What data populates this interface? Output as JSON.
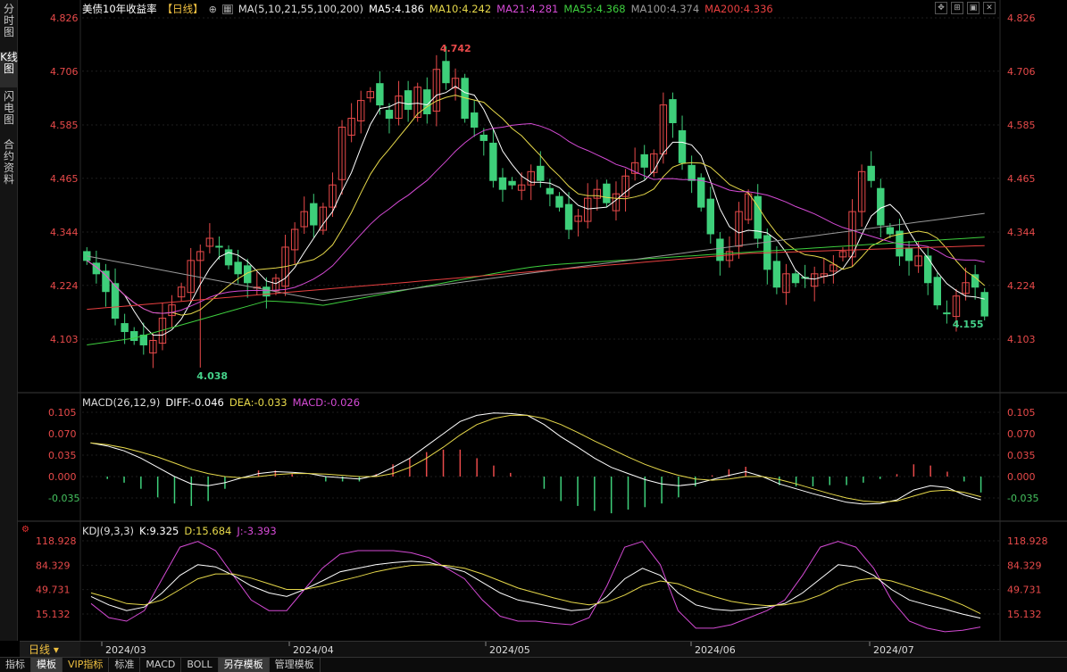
{
  "sidebar": {
    "tabs": [
      {
        "label": "分时图"
      },
      {
        "label": "K线图"
      },
      {
        "label": "闪电图"
      },
      {
        "label": "合约资料"
      }
    ]
  },
  "price_panel": {
    "title": "美债10年收益率",
    "period_badge": "【日线】",
    "ma_header": "MA(5,10,21,55,100,200)",
    "ma": [
      {
        "label": "MA5:4.186",
        "color": "#ffffff"
      },
      {
        "label": "MA10:4.242",
        "color": "#e6d84a"
      },
      {
        "label": "MA21:4.281",
        "color": "#d44ad4"
      },
      {
        "label": "MA55:4.368",
        "color": "#3ecf3e"
      },
      {
        "label": "MA100:4.374",
        "color": "#9a9a9a"
      },
      {
        "label": "MA200:4.336",
        "color": "#e84040"
      }
    ],
    "y_ticks": [
      "4.826",
      "4.706",
      "4.585",
      "4.465",
      "4.344",
      "4.224",
      "4.103"
    ],
    "high_label": "4.742",
    "low_label": "4.038",
    "last_label": "4.155"
  },
  "macd_panel": {
    "header": "MACD(26,12,9)",
    "diff": "DIFF:-0.046",
    "dea": "DEA:-0.033",
    "macd": "MACD:-0.026",
    "y_ticks": [
      "0.105",
      "0.070",
      "0.035",
      "0.000",
      "-0.035"
    ]
  },
  "kdj_panel": {
    "header": "KDJ(9,3,3)",
    "k": "K:9.325",
    "d": "D:15.684",
    "j": "J:-3.393",
    "y_ticks": [
      "118.928",
      "84.329",
      "49.731",
      "15.132"
    ]
  },
  "time_axis": {
    "period": "日线",
    "labels": [
      "2024/03",
      "2024/04",
      "2024/05",
      "2024/06",
      "2024/07"
    ]
  },
  "bottom_tabs": [
    {
      "label": "指标"
    },
    {
      "label": "模板"
    },
    {
      "label": "VIP指标"
    },
    {
      "label": "标准"
    },
    {
      "label": "MACD"
    },
    {
      "label": "BOLL"
    },
    {
      "label": "另存模板"
    },
    {
      "label": "管理模板"
    }
  ],
  "colors": {
    "up": "#e84a4a",
    "down": "#3ecf7a",
    "ma5": "#ffffff",
    "ma10": "#e6d84a",
    "ma21": "#d44ad4",
    "ma55": "#3ecf3e",
    "ma100": "#9a9a9a",
    "ma200": "#e84040"
  },
  "chart_data": [
    {
      "type": "candlestick",
      "title": "美债10年收益率",
      "x_range": [
        "2024/02/26",
        "2024/07/22"
      ],
      "ylim": [
        4.038,
        4.826
      ],
      "close": [
        4.28,
        4.25,
        4.21,
        4.15,
        4.12,
        4.1,
        4.09,
        4.1,
        4.15,
        4.18,
        4.22,
        4.28,
        4.3,
        4.33,
        4.31,
        4.27,
        4.25,
        4.23,
        4.22,
        4.2,
        4.24,
        4.31,
        4.35,
        4.39,
        4.36,
        4.4,
        4.45,
        4.58,
        4.6,
        4.64,
        4.66,
        4.63,
        4.6,
        4.65,
        4.62,
        4.67,
        4.61,
        4.71,
        4.68,
        4.69,
        4.6,
        4.58,
        4.55,
        4.46,
        4.44,
        4.45,
        4.45,
        4.48,
        4.46,
        4.43,
        4.4,
        4.35,
        4.38,
        4.42,
        4.44,
        4.41,
        4.43,
        4.47,
        4.5,
        4.49,
        4.52,
        4.63,
        4.59,
        4.5,
        4.46,
        4.4,
        4.34,
        4.28,
        4.3,
        4.39,
        4.43,
        4.33,
        4.26,
        4.22,
        4.25,
        4.23,
        4.24,
        4.25,
        4.25,
        4.27,
        4.3,
        4.39,
        4.48,
        4.46,
        4.36,
        4.34,
        4.29,
        4.28,
        4.29,
        4.23,
        4.18,
        4.16,
        4.2,
        4.23,
        4.22,
        4.155
      ],
      "high": 4.742,
      "low": 4.038,
      "moving_averages": {
        "MA5": 4.186,
        "MA10": 4.242,
        "MA21": 4.281,
        "MA55": 4.368,
        "MA100": 4.374,
        "MA200": 4.336
      }
    },
    {
      "type": "line",
      "title": "MACD(26,12,9)",
      "ylim": [
        -0.05,
        0.105
      ],
      "series": [
        {
          "name": "DIFF",
          "values": [
            0.055,
            0.05,
            0.042,
            0.03,
            0.015,
            0.0,
            -0.012,
            -0.015,
            -0.01,
            -0.002,
            0.005,
            0.008,
            0.007,
            0.005,
            0.0,
            -0.002,
            -0.004,
            0.002,
            0.015,
            0.03,
            0.05,
            0.07,
            0.09,
            0.1,
            0.104,
            0.103,
            0.1,
            0.085,
            0.065,
            0.048,
            0.03,
            0.015,
            0.005,
            -0.005,
            -0.012,
            -0.015,
            -0.012,
            -0.005,
            0.002,
            0.008,
            0.0,
            -0.012,
            -0.02,
            -0.028,
            -0.035,
            -0.042,
            -0.045,
            -0.044,
            -0.038,
            -0.022,
            -0.015,
            -0.018,
            -0.03,
            -0.038
          ]
        },
        {
          "name": "DEA",
          "values": [
            0.055,
            0.052,
            0.047,
            0.04,
            0.032,
            0.022,
            0.012,
            0.005,
            0.0,
            -0.002,
            0.0,
            0.003,
            0.005,
            0.005,
            0.004,
            0.002,
            0.0,
            0.0,
            0.005,
            0.015,
            0.03,
            0.048,
            0.068,
            0.085,
            0.095,
            0.1,
            0.1,
            0.095,
            0.085,
            0.072,
            0.058,
            0.045,
            0.032,
            0.02,
            0.01,
            0.002,
            -0.004,
            -0.006,
            -0.004,
            0.0,
            0.0,
            -0.005,
            -0.012,
            -0.02,
            -0.028,
            -0.035,
            -0.04,
            -0.042,
            -0.04,
            -0.032,
            -0.024,
            -0.022,
            -0.026,
            -0.033
          ]
        },
        {
          "name": "MACD",
          "values": [
            0.0,
            -0.004,
            -0.01,
            -0.02,
            -0.034,
            -0.044,
            -0.048,
            -0.04,
            -0.02,
            0.0,
            0.01,
            0.01,
            0.004,
            0.0,
            -0.008,
            -0.008,
            -0.008,
            0.004,
            0.02,
            0.03,
            0.04,
            0.044,
            0.044,
            0.03,
            0.018,
            0.006,
            0.0,
            -0.02,
            -0.04,
            -0.048,
            -0.056,
            -0.06,
            -0.054,
            -0.05,
            -0.044,
            -0.034,
            -0.016,
            0.002,
            0.012,
            0.016,
            0.0,
            -0.014,
            -0.016,
            -0.016,
            -0.014,
            -0.014,
            -0.01,
            -0.004,
            0.004,
            0.02,
            0.018,
            0.008,
            -0.008,
            -0.026
          ]
        }
      ]
    },
    {
      "type": "line",
      "title": "KDJ(9,3,3)",
      "ylim": [
        -3.393,
        118.928
      ],
      "series": [
        {
          "name": "K",
          "values": [
            40,
            28,
            20,
            25,
            45,
            70,
            85,
            82,
            70,
            55,
            45,
            40,
            50,
            62,
            75,
            80,
            85,
            88,
            90,
            88,
            82,
            75,
            60,
            45,
            35,
            30,
            25,
            20,
            22,
            40,
            65,
            80,
            70,
            45,
            28,
            22,
            20,
            22,
            25,
            30,
            45,
            65,
            85,
            82,
            70,
            50,
            35,
            28,
            22,
            15,
            9.3
          ]
        },
        {
          "name": "D",
          "values": [
            45,
            38,
            30,
            28,
            35,
            50,
            65,
            72,
            72,
            66,
            58,
            50,
            50,
            55,
            62,
            68,
            75,
            80,
            84,
            85,
            84,
            80,
            72,
            62,
            52,
            45,
            38,
            32,
            28,
            32,
            42,
            55,
            62,
            58,
            48,
            40,
            33,
            29,
            27,
            28,
            33,
            42,
            55,
            63,
            66,
            62,
            54,
            46,
            38,
            28,
            15.7
          ]
        },
        {
          "name": "J",
          "values": [
            30,
            10,
            5,
            20,
            65,
            110,
            118,
            105,
            70,
            35,
            20,
            20,
            50,
            80,
            100,
            105,
            105,
            105,
            102,
            95,
            80,
            65,
            35,
            12,
            5,
            5,
            2,
            0,
            10,
            55,
            110,
            118,
            85,
            20,
            -5,
            -5,
            0,
            10,
            20,
            35,
            70,
            110,
            118,
            110,
            80,
            35,
            5,
            -5,
            -10,
            -8,
            -3.4
          ]
        }
      ]
    }
  ]
}
